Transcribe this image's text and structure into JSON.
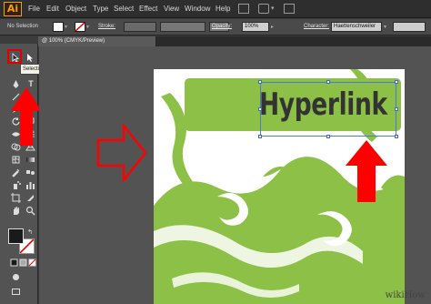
{
  "app": {
    "logo_text": "Ai"
  },
  "menu": {
    "items": [
      "File",
      "Edit",
      "Object",
      "Type",
      "Select",
      "Effect",
      "View",
      "Window",
      "Help"
    ]
  },
  "control_bar": {
    "selection_label": "No Selection",
    "stroke_label": "Stroke:",
    "opacity_label": "Opacity:",
    "opacity_value": "100%",
    "character_label": "Character:",
    "font_value": "Haettenschweiler"
  },
  "document": {
    "tab_title": "@ 100% (CMYK/Preview)"
  },
  "tools": {
    "tooltip": "Selection Tool (V)",
    "type_glyph": "T"
  },
  "artwork": {
    "headline": "Hyperlink",
    "banner_color": "#8dc046",
    "swirl_color": "#8dc046"
  },
  "watermark": "wikiHow",
  "colors": {
    "annotation_red": "#ff0000",
    "selection_blue": "#3c69d6"
  }
}
